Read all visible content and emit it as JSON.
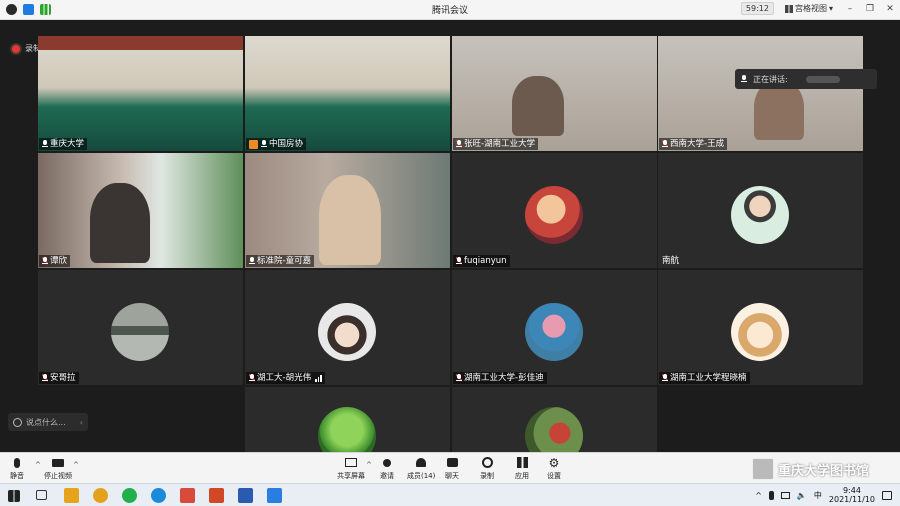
{
  "window": {
    "title": "腾讯会议",
    "timer": "59:12",
    "view_label": "宫格视图"
  },
  "recording": {
    "label": "录制中"
  },
  "speaking": {
    "label": "正在讲话:"
  },
  "tiles": [
    {
      "name": "重庆大学",
      "mic": "on"
    },
    {
      "name": "中国房协",
      "mic": "on",
      "host": true
    },
    {
      "name": "张旺-湖南工业大学",
      "mic": "muted"
    },
    {
      "name": "西南大学-王成",
      "mic": "muted"
    },
    {
      "name": "谭欣",
      "mic": "muted"
    },
    {
      "name": "标准院-童可嘉",
      "mic": "on"
    },
    {
      "name": "fuqianyun",
      "mic": "muted"
    },
    {
      "name": "南航",
      "mic": "none"
    },
    {
      "name": "安哥拉",
      "mic": "muted"
    },
    {
      "name": "湖工大-胡光伟",
      "mic": "muted",
      "bars": true
    },
    {
      "name": "湖南工业大学-彭佳迪",
      "mic": "muted"
    },
    {
      "name": "湖南工业大学程晓楠",
      "mic": "muted"
    },
    {
      "name": "",
      "mic": "none"
    },
    {
      "name": "",
      "mic": "none"
    }
  ],
  "chat": {
    "placeholder": "说点什么..."
  },
  "toolbar": {
    "mute": "静音",
    "stop_video": "停止视频",
    "share_screen": "共享屏幕",
    "invite": "邀请",
    "members": "成员(14)",
    "chat": "聊天",
    "record": "录制",
    "apps": "应用",
    "settings": "设置"
  },
  "watermark": {
    "text": "重庆大学图书馆"
  },
  "taskbar": {
    "ime": "中",
    "time": "9:44",
    "date": "2021/11/10"
  }
}
